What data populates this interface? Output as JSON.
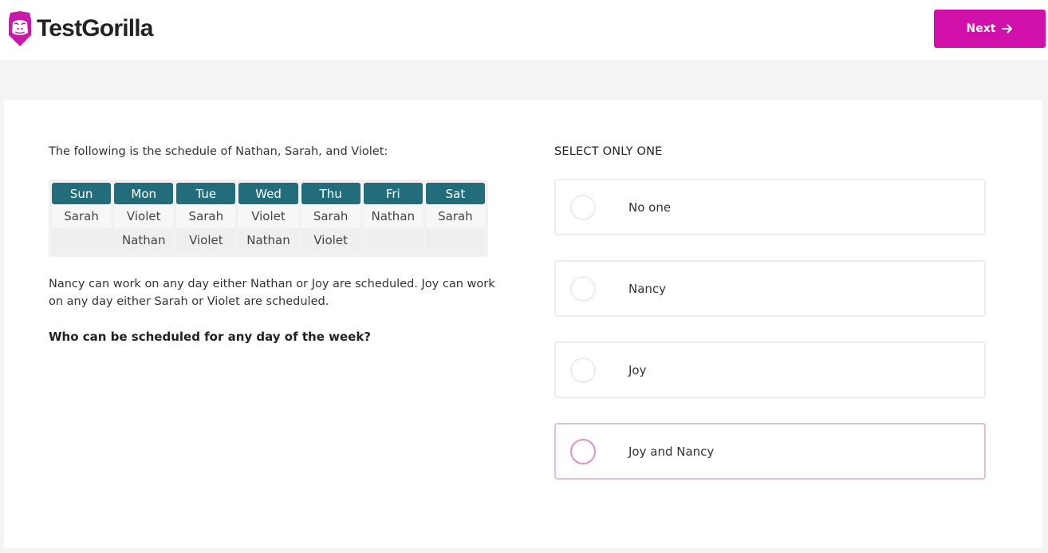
{
  "header": {
    "brand": "TestGorilla",
    "logo_icon": "gorilla-icon",
    "next_label": "Next",
    "next_icon": "arrow-right-icon",
    "accent_color": "#d010a8"
  },
  "question": {
    "intro": "The following is the schedule of Nathan, Sarah, and Violet:",
    "schedule": {
      "days": [
        "Sun",
        "Mon",
        "Tue",
        "Wed",
        "Thu",
        "Fri",
        "Sat"
      ],
      "row1": [
        "Sarah",
        "Violet",
        "Sarah",
        "Violet",
        "Sarah",
        "Nathan",
        "Sarah"
      ],
      "row2": [
        "",
        "Nathan",
        "Violet",
        "Nathan",
        "Violet",
        "",
        ""
      ]
    },
    "paragraph": "Nancy can work on any day either Nathan or Joy are scheduled. Joy can work on any day either Sarah or Violet are scheduled.",
    "prompt": "Who can be scheduled for any day of the week?"
  },
  "answers": {
    "instruction": "SELECT ONLY ONE",
    "options": [
      {
        "label": "No one"
      },
      {
        "label": "Nancy"
      },
      {
        "label": "Joy"
      },
      {
        "label": "Joy and Nancy"
      }
    ]
  }
}
